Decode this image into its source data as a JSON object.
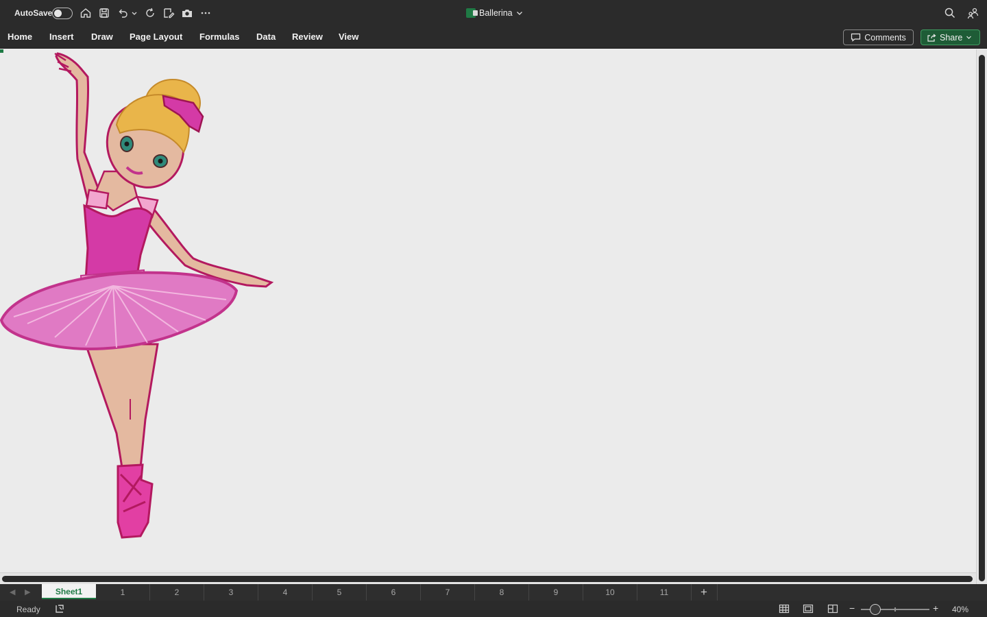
{
  "titlebar": {
    "autosave_label": "AutoSave",
    "autosave_on": false,
    "icons": [
      "home-icon",
      "save-icon",
      "undo-icon",
      "undo-dropdown-icon",
      "redo-icon",
      "edit-icon",
      "camera-icon",
      "more-icon"
    ],
    "document_title": "Ballerina",
    "right_icons": [
      "search-icon",
      "people-icon"
    ]
  },
  "menu": {
    "items": [
      "Home",
      "Insert",
      "Draw",
      "Page Layout",
      "Formulas",
      "Data",
      "Review",
      "View"
    ],
    "comments_label": "Comments",
    "share_label": "Share"
  },
  "sheets": {
    "active": "Sheet1",
    "pages": [
      "1",
      "2",
      "3",
      "4",
      "5",
      "6",
      "7",
      "8",
      "9",
      "10",
      "11"
    ],
    "add_label": "+"
  },
  "status": {
    "ready_text": "Ready",
    "zoom_level": "40%",
    "zoom_minus": "−",
    "zoom_plus": "+",
    "view_icons": [
      "normal-view-icon",
      "page-layout-view-icon",
      "page-break-view-icon"
    ]
  },
  "colors": {
    "accent": "#1f7a45",
    "chrome": "#2b2b2b",
    "tutu": "#e07ac4",
    "bodice": "#d43aa6",
    "skin": "#e4b9a0",
    "hair": "#e9b54a"
  }
}
